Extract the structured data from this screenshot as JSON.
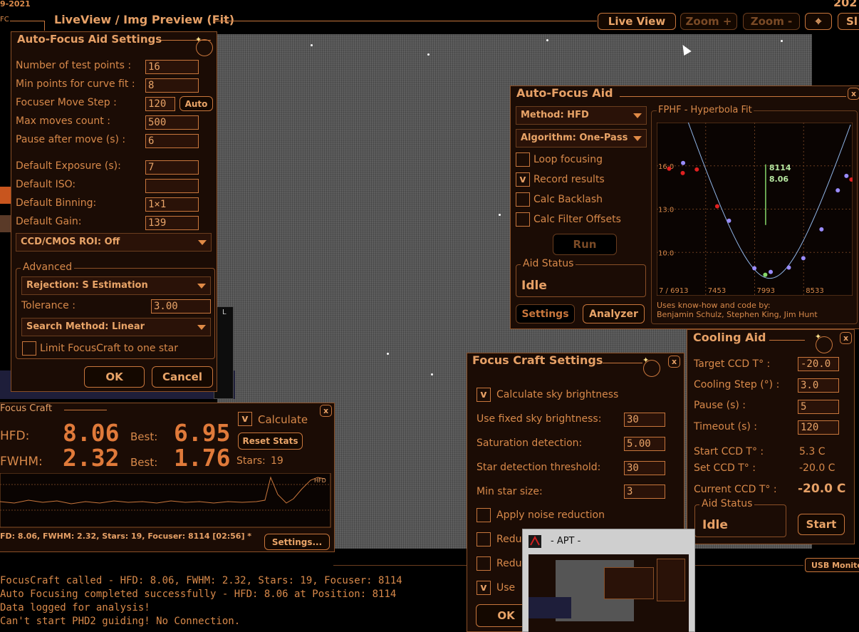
{
  "header": {
    "date_fragment": "9-2021",
    "title": "LiveView / Img Preview (Fit)",
    "left_fragment": "FC",
    "right_fragment": "202",
    "buttons": {
      "live_view": "Live View",
      "zoom_plus": "Zoom +",
      "zoom_minus": "Zoom -",
      "target": "⌖",
      "right_cut": "Sl"
    }
  },
  "af_settings": {
    "title": "Auto-Focus Aid Settings",
    "fields": [
      {
        "label": "Number of test points :",
        "value": "16"
      },
      {
        "label": "Min points for curve fit :",
        "value": "8"
      },
      {
        "label": "Focuser Move Step :",
        "value": "120"
      },
      {
        "label": "Max moves count :",
        "value": "500"
      },
      {
        "label": "Pause after move (s) :",
        "value": "6"
      },
      {
        "label": "Default Exposure (s):",
        "value": "7"
      },
      {
        "label": "Default ISO:",
        "value": ""
      },
      {
        "label": "Default Binning:",
        "value": "1×1"
      },
      {
        "label": "Default Gain:",
        "value": "139"
      }
    ],
    "auto_button": "Auto",
    "roi": "CCD/CMOS ROI: Off",
    "advanced_label": "Advanced",
    "rejection": "Rejection: S Estimation",
    "tolerance_label": "Tolerance :",
    "tolerance_value": "3.00",
    "search_method": "Search Method: Linear",
    "limit_label": "Limit FocusCraft to one star",
    "ok": "OK",
    "cancel": "Cancel",
    "side_letter": "L"
  },
  "af_aid": {
    "title": "Auto-Focus Aid",
    "close": "x",
    "method": "Method: HFD",
    "algorithm": "Algorithm: One-Pass",
    "checks": [
      {
        "label": "Loop focusing",
        "checked": ""
      },
      {
        "label": "Record results",
        "checked": "v"
      },
      {
        "label": "Calc Backlash",
        "checked": ""
      },
      {
        "label": "Calc Filter Offsets",
        "checked": ""
      }
    ],
    "run": "Run",
    "status_label": "Aid Status",
    "status": "Idle",
    "settings": "Settings",
    "analyzer": "Analyzer",
    "chart_title": "FPHF - Hyperbola Fit",
    "credits1": "Uses know-how and code by:",
    "credits2": "Benjamin Schulz, Stephen King, Jim Hunt"
  },
  "chart_data": {
    "type": "scatter",
    "title": "FPHF - Hyperbola Fit",
    "xlabel": "",
    "ylabel": "",
    "x_ticks": [
      "7 / 6913",
      "7453",
      "7993",
      "8533"
    ],
    "y_ticks": [
      "16.0",
      "13.0",
      "10.0"
    ],
    "xlim": [
      6913,
      9073
    ],
    "ylim": [
      7,
      19
    ],
    "grid": true,
    "series": [
      {
        "name": "",
        "color": "#9a8cff",
        "points": [
          [
            7204,
            16.2
          ],
          [
            7710,
            12.2
          ],
          [
            7990,
            8.9
          ],
          [
            8170,
            8.65
          ],
          [
            8370,
            8.95
          ],
          [
            8530,
            9.6
          ],
          [
            8730,
            11.6
          ],
          [
            8910,
            14.3
          ],
          [
            9005,
            15.3
          ]
        ]
      },
      {
        "name": "",
        "color": "#e02020",
        "points": [
          [
            7050,
            15.8
          ],
          [
            7200,
            15.5
          ],
          [
            7355,
            15.75
          ],
          [
            7580,
            13.2
          ],
          [
            9060,
            15.05
          ]
        ]
      },
      {
        "name": "",
        "color": "#86d86a",
        "points": [
          [
            8110,
            8.45
          ]
        ]
      }
    ],
    "curve_color": "#8fb4e6",
    "fit_line_color": "#86d86a",
    "fit_x": 8114,
    "fit_label_position": "8114",
    "fit_label_hfd": "8.06"
  },
  "focus_craft": {
    "title": "Focus Craft",
    "close": "x",
    "calc_check": "v",
    "calc_label": "Calculate",
    "reset": "Reset Stats",
    "hfd_label": "HFD:",
    "hfd_value": "8.06",
    "best_label": "Best:",
    "best_hfd": "6.95",
    "fwhm_label": "FWHM:",
    "fwhm_value": "2.32",
    "best_fwhm": "1.76",
    "stars_label": "Stars:",
    "stars_value": "19",
    "graph_label": "HFD",
    "status": "FD: 8.06, FWHM: 2.32, Stars: 19, Focuser: 8114 [02:56] *",
    "settings": "Settings..."
  },
  "fc_settings": {
    "title": "Focus Craft Settings",
    "close": "x",
    "calc_sky_check": "v",
    "calc_sky": "Calculate sky brightness",
    "fields": [
      {
        "label": "Use fixed sky brightness:",
        "value": "30"
      },
      {
        "label": "Saturation detection:",
        "value": "5.00"
      },
      {
        "label": "Star detection threshold:",
        "value": "30"
      },
      {
        "label": "Min star size:",
        "value": "3"
      }
    ],
    "noise_label": "Apply noise reduction",
    "redu1": "Redu",
    "redu2": "Redu",
    "use_check": "v",
    "use_label": "Use",
    "ok": "OK"
  },
  "cooling": {
    "title": "Cooling Aid",
    "close": "x",
    "fields": [
      {
        "label": "Target CCD T° :",
        "value": "-20.0"
      },
      {
        "label": "Cooling Step (°) :",
        "value": "3.0"
      },
      {
        "label": "Pause (s) :",
        "value": "5"
      },
      {
        "label": "Timeout (s) :",
        "value": "120"
      }
    ],
    "start_label": "Start CCD T° :",
    "start_value": "5.3 C",
    "set_label": "Set CCD T° :",
    "set_value": "-20.0 C",
    "current_label": "Current CCD T° :",
    "current_value": "-20.0 C",
    "status_label": "Aid Status",
    "status": "Idle",
    "start": "Start"
  },
  "usb": "USB Monito",
  "taskbar": {
    "title": "- APT -"
  },
  "log": [
    "FocusCraft called - HFD: 8.06, FWHM: 2.32, Stars: 19, Focuser: 8114",
    "Auto Focusing completed successfully - HFD: 8.06 at Position: 8114",
    "Data logged for analysis!",
    "Can't start PHD2 guiding! No Connection."
  ]
}
